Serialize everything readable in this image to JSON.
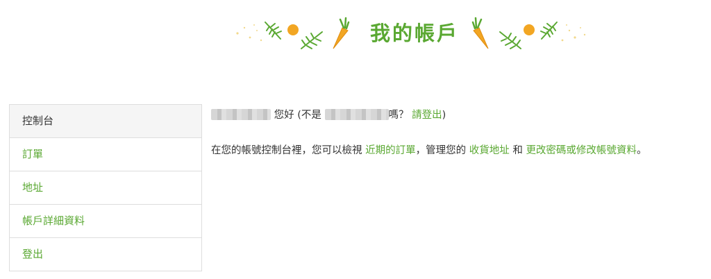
{
  "page": {
    "title": "我的帳戶",
    "accent_color": "#5aa832",
    "orange_color": "#f2a623"
  },
  "sidebar": {
    "items": [
      {
        "label": "控制台",
        "active": true
      },
      {
        "label": "訂單",
        "active": false
      },
      {
        "label": "地址",
        "active": false
      },
      {
        "label": "帳戶詳細資料",
        "active": false
      },
      {
        "label": "登出",
        "active": false
      }
    ]
  },
  "greeting": {
    "hello": "您好 (不是",
    "question": "嗎？",
    "logout_link": "請登出",
    "close_paren": ")"
  },
  "intro": {
    "prefix": "在您的帳號控制台裡，您可以檢視",
    "recent_orders_link": "近期的訂單",
    "mid1": "，管理您的",
    "addresses_link": "收貨地址",
    "mid2": "和",
    "account_details_link": "更改密碼或修改帳號資料",
    "suffix": "。"
  }
}
